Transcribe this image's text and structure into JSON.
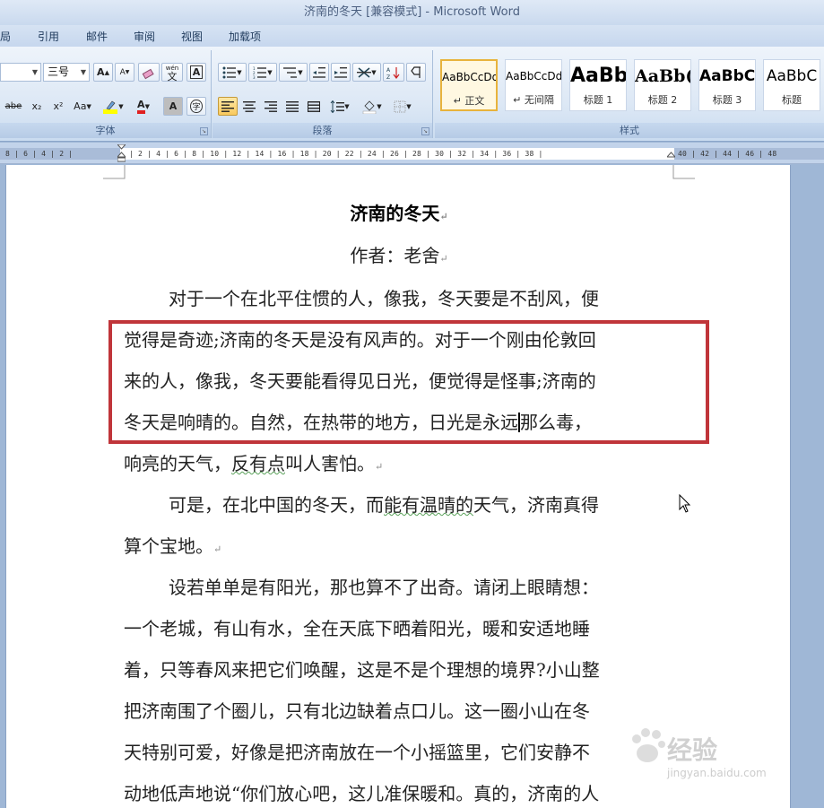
{
  "window": {
    "title": "济南的冬天 [兼容模式] - Microsoft Word"
  },
  "tabs": [
    "局",
    "引用",
    "邮件",
    "审阅",
    "视图",
    "加载项"
  ],
  "ribbon": {
    "font_group": {
      "label": "字体",
      "font_size": "三号",
      "grow_font": "A",
      "shrink_font": "A",
      "strikethrough": "abe",
      "subscript": "x₂",
      "superscript": "x²",
      "change_case": "Aa",
      "font_color": "A",
      "char_shading": "A",
      "enclose": "字",
      "phonetic": "wén"
    },
    "paragraph_group": {
      "label": "段落"
    },
    "styles_group": {
      "label": "样式",
      "styles": [
        {
          "preview": "AaBbCcDd",
          "name": "正文",
          "active": true
        },
        {
          "preview": "AaBbCcDd",
          "name": "无间隔",
          "active": false
        },
        {
          "preview": "AaBb",
          "name": "标题 1",
          "active": false
        },
        {
          "preview": "AaBb(",
          "name": "标题 2",
          "active": false
        },
        {
          "preview": "AaBbC",
          "name": "标题 3",
          "active": false
        },
        {
          "preview": "AaBbC",
          "name": "标题",
          "active": false
        }
      ]
    }
  },
  "ruler": {
    "left_ticks": "8 | 6 | 4 | 2 |",
    "main_ticks": "| 2 | 4 | 6 | 8 | 10 | 12 | 14 | 16 | 18 | 20 | 22 | 24 | 26 | 28 | 30 | 32 | 34 | 36 | 38 |",
    "right_ticks": "40 | 42 | 44 | 46 | 48"
  },
  "document": {
    "title": "济南的冬天",
    "author": "作者：老舍",
    "lines": [
      "对于一个在北平住惯的人，像我，冬天要是不刮风，便",
      "觉得是奇迹;济南的冬天是没有风声的。对于一个刚由伦敦回",
      "来的人，像我，冬天要能看得见日光，便觉得是怪事;济南的",
      "冬天是响晴的。自然，在热带的地方，日光是永远",
      "那么毒，",
      "响亮的天气，",
      "反有点",
      "叫人害怕。",
      "可是，在北中国的冬天，而",
      "能有温晴的",
      "天气，济南真得",
      "算个宝地。",
      "设若单单是有阳光，那也算不了出奇。请闭上眼睛想：",
      "一个老城，有山有水，全在天底下晒着阳光，暖和安适地睡",
      "着，只等春风来把它们唤醒，这是不是个理想的境界?小山整",
      "把济南围了个圈儿，只有北边缺着点口儿。这一圈小山在冬",
      "天特别可爱，好像是把济南放在一个小摇篮里，它们安静不",
      "动地低声地说“你们放心吧，这儿准保暖和。真的，济南的人"
    ],
    "paragraph_mark": "↵"
  },
  "watermark": {
    "main": "经验",
    "sub": "jingyan.baidu.com"
  },
  "colors": {
    "highlight_box": "#c0353a",
    "ribbon_bg": "#dde8f5",
    "frame": "#9fb7d6"
  }
}
